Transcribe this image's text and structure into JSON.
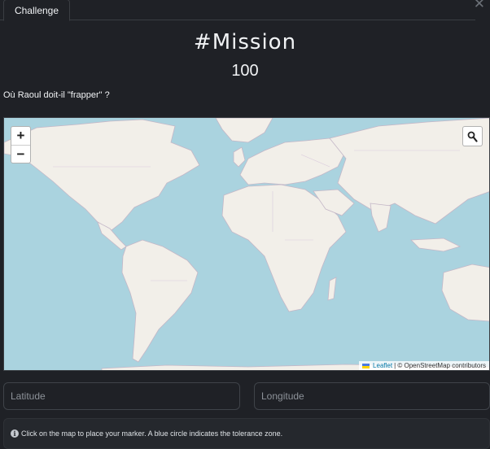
{
  "tabs": [
    {
      "label": "Challenge"
    }
  ],
  "challenge": {
    "title": "#Mission",
    "points": "100",
    "question": "Où Raoul doit-il \"frapper\" ?"
  },
  "map": {
    "zoom_in": "+",
    "zoom_out": "−",
    "attribution_leaflet": "Leaflet",
    "attribution_rest": "| © OpenStreetMap contributors",
    "colors": {
      "water": "#aad3df",
      "land": "#f2efe9",
      "border": "#b5a6b9"
    }
  },
  "form": {
    "latitude_placeholder": "Latitude",
    "longitude_placeholder": "Longitude"
  },
  "hint": "Click on the map to place your marker. A blue circle indicates the tolerance zone."
}
